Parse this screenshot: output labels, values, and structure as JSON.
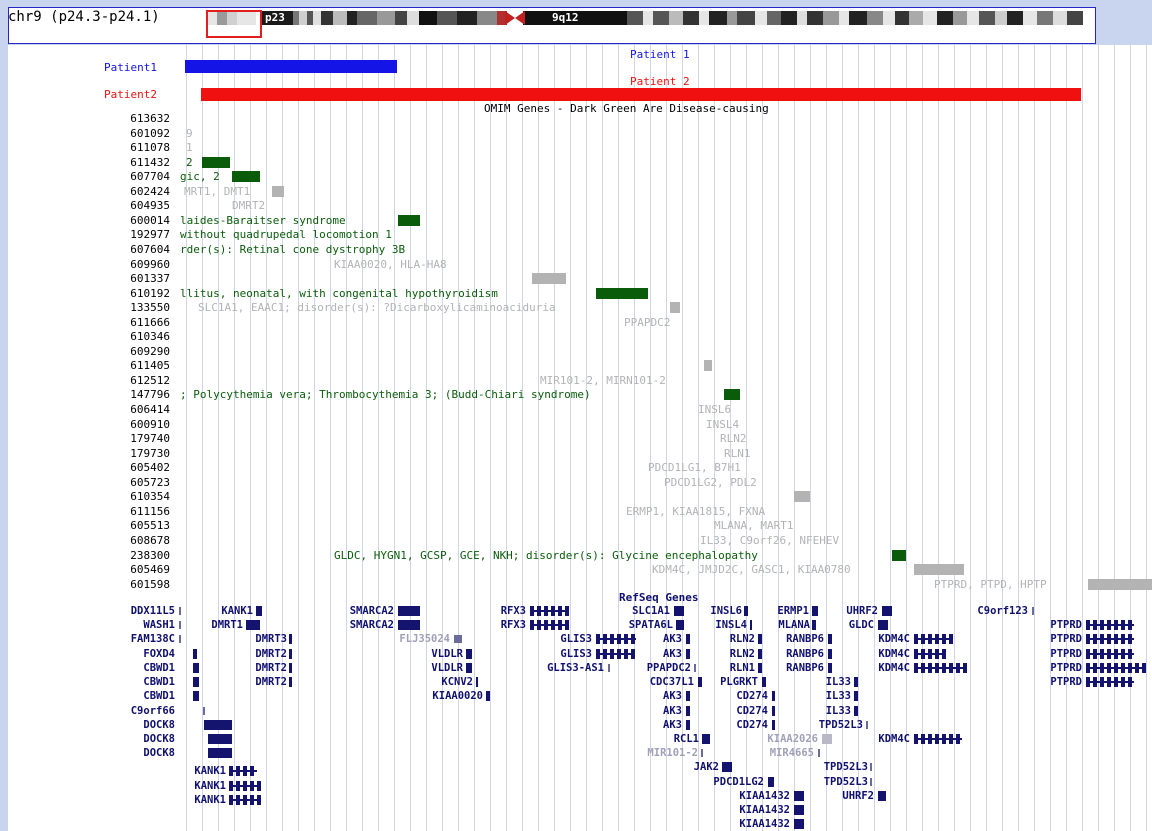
{
  "ideogram": {
    "chrom_label": "chr9 (p24.3-p24.1)",
    "band_p": "p23",
    "band_q": "9q12"
  },
  "tracks": {
    "patient1_label": "Patient1",
    "patient2_label": "Patient2",
    "patient1_title": "Patient 1",
    "patient2_title": "Patient 2",
    "patient1_color": "#1414e6",
    "patient2_color": "#f01010"
  },
  "omim": {
    "title": "OMIM Genes - Dark Green Are Disease-causing",
    "rows": [
      {
        "id": "613632",
        "text": ""
      },
      {
        "id": "601092",
        "text": "9"
      },
      {
        "id": "611078",
        "text": "1"
      },
      {
        "id": "611432",
        "text": "2"
      },
      {
        "id": "607704",
        "text": "gic, 2"
      },
      {
        "id": "602424",
        "text": "MRT1, DMT1"
      },
      {
        "id": "604935",
        "text": "DMRT2"
      },
      {
        "id": "600014",
        "text": "laides-Baraitser syndrome"
      },
      {
        "id": "192977",
        "text": "without quadrupedal locomotion 1"
      },
      {
        "id": "607604",
        "text": "rder(s): Retinal cone dystrophy 3B"
      },
      {
        "id": "609960",
        "text": "KIAA0020, HLA-HA8"
      },
      {
        "id": "601337",
        "text": ""
      },
      {
        "id": "610192",
        "text": "llitus, neonatal, with congenital hypothyroidism"
      },
      {
        "id": "133550",
        "text": "SLC1A1, EAAC1; disorder(s): ?Dicarboxylicaminoaciduria"
      },
      {
        "id": "611666",
        "text": "PPAPDC2"
      },
      {
        "id": "610346",
        "text": ""
      },
      {
        "id": "609290",
        "text": ""
      },
      {
        "id": "611405",
        "text": ""
      },
      {
        "id": "612512",
        "text": "MIR101-2, MIRN101-2"
      },
      {
        "id": "147796",
        "text": "; Polycythemia vera; Thrombocythemia 3; (Budd-Chiari syndrome)"
      },
      {
        "id": "606414",
        "text": "INSL6"
      },
      {
        "id": "600910",
        "text": "INSL4"
      },
      {
        "id": "179740",
        "text": "RLN2"
      },
      {
        "id": "179730",
        "text": "RLN1"
      },
      {
        "id": "605402",
        "text": "PDCD1LG1, B7H1"
      },
      {
        "id": "605723",
        "text": "PDCD1LG2, PDL2"
      },
      {
        "id": "610354",
        "text": ""
      },
      {
        "id": "611156",
        "text": "ERMP1, KIAA1815, FXNA"
      },
      {
        "id": "605513",
        "text": "MLANA, MART1"
      },
      {
        "id": "608678",
        "text": "IL33, C9orf26, NFEHEV"
      },
      {
        "id": "238300",
        "text": "GLDC, HYGN1, GCSP, GCE, NKH; disorder(s): Glycine encephalopathy"
      },
      {
        "id": "605469",
        "text": "KDM4C, JMJD2C, GASC1, KIAA0780"
      },
      {
        "id": "601598",
        "text": "PTPRD, PTPD, HPTP"
      }
    ]
  },
  "refseq": {
    "title": "RefSeq Genes",
    "genes": [
      "DDX11L5",
      "WASH1",
      "FAM138C",
      "FOXD4",
      "CBWD1",
      "CBWD1",
      "CBWD1",
      "C9orf66",
      "DOCK8",
      "DOCK8",
      "DOCK8",
      "KANK1",
      "DMRT1",
      "DMRT3",
      "DMRT2",
      "DMRT2",
      "DMRT2",
      "KANK1",
      "KANK1",
      "KANK1",
      "SMARCA2",
      "SMARCA2",
      "FLJ35024",
      "VLDLR",
      "VLDLR",
      "KCNV2",
      "KIAA0020",
      "RFX3",
      "RFX3",
      "GLIS3",
      "GLIS3",
      "GLIS3-AS1",
      "SLC1A1",
      "SPATA6L",
      "AK3",
      "AK3",
      "PPAPDC2",
      "CDC37L1",
      "AK3",
      "AK3",
      "AK3",
      "RCL1",
      "MIR101-2",
      "JAK2",
      "INSL6",
      "INSL4",
      "RLN2",
      "RLN2",
      "RLN1",
      "PLGRKT",
      "CD274",
      "CD274",
      "CD274",
      "KIAA2026",
      "MIR4665",
      "PDCD1LG2",
      "KIAA1432",
      "KIAA1432",
      "KIAA1432",
      "ERMP1",
      "MLANA",
      "RANBP6",
      "RANBP6",
      "RANBP6",
      "IL33",
      "IL33",
      "IL33",
      "TPD52L3",
      "TPD52L3",
      "TPD52L3",
      "UHRF2",
      "GLDC",
      "KDM4C",
      "KDM4C",
      "KDM4C",
      "KDM4C",
      "UHRF2",
      "C9orf123",
      "PTPRD",
      "PTPRD",
      "PTPRD",
      "PTPRD",
      "PTPRD"
    ]
  },
  "colors": {
    "disease_green": "#0a5c0a",
    "gray": "#b3b3b3",
    "navy": "#14146e"
  }
}
